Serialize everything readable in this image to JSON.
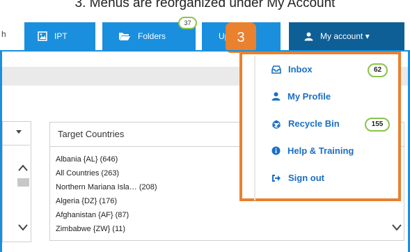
{
  "caption": "3. Menus are reorganized under My Account",
  "toolbar": {
    "left_fragment": "h",
    "ipt_label": "IPT",
    "folders_label": "Folders",
    "folders_badge": "37",
    "up_label": "Up",
    "account_label": "My account ▾",
    "step_number": "3"
  },
  "account_menu": {
    "items": [
      {
        "label": "Inbox",
        "icon": "inbox-icon",
        "badge": "62"
      },
      {
        "label": "My Profile",
        "icon": "user-icon",
        "badge": ""
      },
      {
        "label": "Recycle Bin",
        "icon": "recycle-icon",
        "badge": "155"
      },
      {
        "label": "Help & Training",
        "icon": "info-icon",
        "badge": ""
      },
      {
        "label": "Sign out",
        "icon": "sign-out-icon",
        "badge": ""
      }
    ]
  },
  "target_countries": {
    "header": "Target Countries",
    "items": [
      "Albania {AL} (646)",
      "All Countries (263)",
      "Northern Mariana Isla… (208)",
      "Algeria {DZ} (176)",
      "Afghanistan {AF} (87)",
      "Zimbabwe {ZW} (11)"
    ]
  },
  "colors": {
    "primary": "#1a8fdd",
    "account": "#0e5f96",
    "highlight": "#e9812f",
    "badge_border": "#8bc34a",
    "menu_text": "#1a6fc4"
  }
}
